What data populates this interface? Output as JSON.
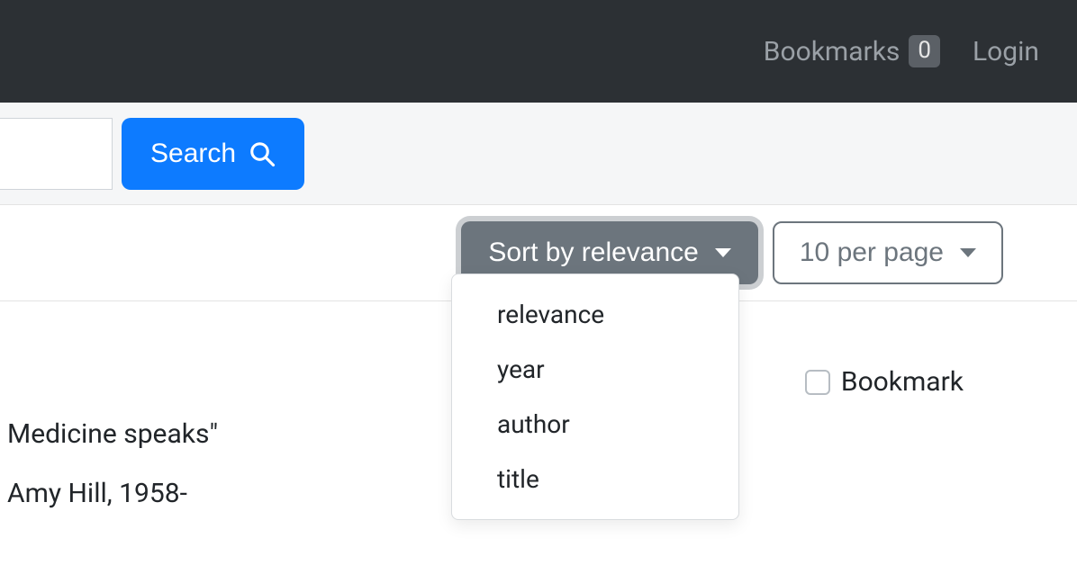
{
  "header": {
    "bookmarks_label": "Bookmarks",
    "bookmarks_count": "0",
    "login_label": "Login"
  },
  "search": {
    "button_label": "Search"
  },
  "sort": {
    "button_label": "Sort by relevance",
    "options": [
      "relevance",
      "year",
      "author",
      "title"
    ]
  },
  "per_page": {
    "button_label": "10 per page"
  },
  "result": {
    "title_fragment": "Medicine speaks\"",
    "author_fragment": "Amy Hill, 1958-",
    "bookmark_label": "Bookmark"
  }
}
